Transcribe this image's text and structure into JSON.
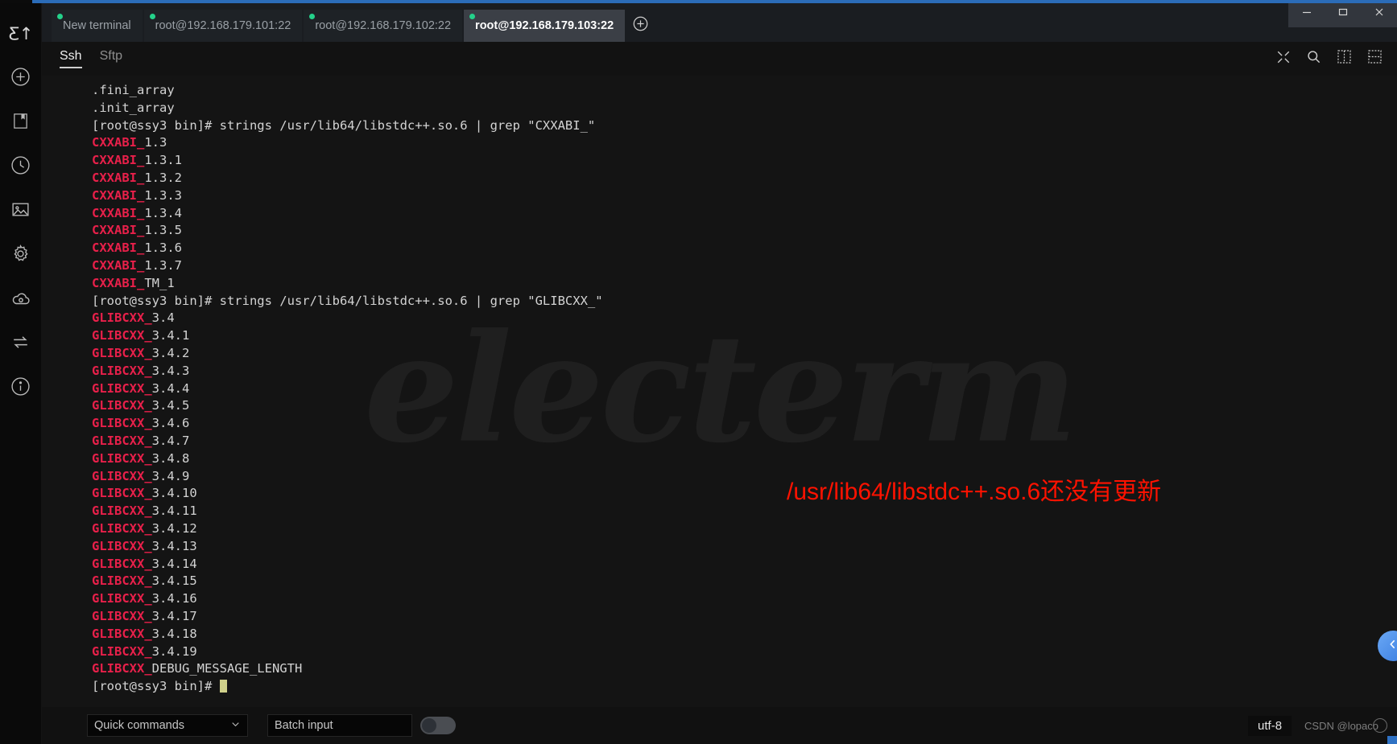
{
  "window": {
    "controls": [
      {
        "name": "minimize",
        "glyph": "minimize-icon"
      },
      {
        "name": "maximize",
        "glyph": "maximize-icon"
      },
      {
        "name": "close",
        "glyph": "close-icon"
      }
    ],
    "accent_color": "#2b6cb8"
  },
  "sidebar": {
    "logo_text": "Ƹ↑",
    "items": [
      {
        "icon": "plus-circle-icon",
        "label": "New"
      },
      {
        "icon": "bookmark-icon",
        "label": "Bookmarks"
      },
      {
        "icon": "clock-icon",
        "label": "History"
      },
      {
        "icon": "image-icon",
        "label": "Theme"
      },
      {
        "icon": "gear-icon",
        "label": "Settings"
      },
      {
        "icon": "cloud-icon",
        "label": "Sync"
      },
      {
        "icon": "transfer-icon",
        "label": "Transfer"
      },
      {
        "icon": "info-icon",
        "label": "About"
      }
    ]
  },
  "tabs": {
    "items": [
      {
        "label": "New terminal",
        "active": false,
        "status": "connected"
      },
      {
        "label": "root@192.168.179.101:22",
        "active": false,
        "status": "connected"
      },
      {
        "label": "root@192.168.179.102:22",
        "active": false,
        "status": "connected"
      },
      {
        "label": "root@192.168.179.103:22",
        "active": true,
        "status": "connected"
      }
    ],
    "add_label": "+",
    "status_dot_color": "#24d18a"
  },
  "subbar": {
    "tabs": [
      {
        "label": "Ssh",
        "active": true
      },
      {
        "label": "Sftp",
        "active": false
      }
    ],
    "tools": [
      {
        "icon": "fullscreen-icon",
        "label": "Toggle fullscreen"
      },
      {
        "icon": "search-icon",
        "label": "Search"
      },
      {
        "icon": "split-vertical-icon",
        "label": "Split vertically"
      },
      {
        "icon": "split-horizontal-icon",
        "label": "Split horizontally"
      }
    ]
  },
  "terminal": {
    "watermark": "electerm",
    "prompt": "[root@ssy3 bin]#",
    "lines": [
      {
        "type": "plain",
        "text": ".fini_array"
      },
      {
        "type": "plain",
        "text": ".init_array"
      },
      {
        "type": "prompt",
        "prompt": "[root@ssy3 bin]# ",
        "command": "strings /usr/lib64/libstdc++.so.6 | grep \"CXXABI_\""
      },
      {
        "type": "match",
        "match": "CXXABI_",
        "rest": "1.3"
      },
      {
        "type": "match",
        "match": "CXXABI_",
        "rest": "1.3.1"
      },
      {
        "type": "match",
        "match": "CXXABI_",
        "rest": "1.3.2"
      },
      {
        "type": "match",
        "match": "CXXABI_",
        "rest": "1.3.3"
      },
      {
        "type": "match",
        "match": "CXXABI_",
        "rest": "1.3.4"
      },
      {
        "type": "match",
        "match": "CXXABI_",
        "rest": "1.3.5"
      },
      {
        "type": "match",
        "match": "CXXABI_",
        "rest": "1.3.6"
      },
      {
        "type": "match",
        "match": "CXXABI_",
        "rest": "1.3.7"
      },
      {
        "type": "match",
        "match": "CXXABI_",
        "rest": "TM_1"
      },
      {
        "type": "prompt",
        "prompt": "[root@ssy3 bin]# ",
        "command": "strings /usr/lib64/libstdc++.so.6 | grep \"GLIBCXX_\""
      },
      {
        "type": "match",
        "match": "GLIBCXX_",
        "rest": "3.4"
      },
      {
        "type": "match",
        "match": "GLIBCXX_",
        "rest": "3.4.1"
      },
      {
        "type": "match",
        "match": "GLIBCXX_",
        "rest": "3.4.2"
      },
      {
        "type": "match",
        "match": "GLIBCXX_",
        "rest": "3.4.3"
      },
      {
        "type": "match",
        "match": "GLIBCXX_",
        "rest": "3.4.4"
      },
      {
        "type": "match",
        "match": "GLIBCXX_",
        "rest": "3.4.5"
      },
      {
        "type": "match",
        "match": "GLIBCXX_",
        "rest": "3.4.6"
      },
      {
        "type": "match",
        "match": "GLIBCXX_",
        "rest": "3.4.7"
      },
      {
        "type": "match",
        "match": "GLIBCXX_",
        "rest": "3.4.8"
      },
      {
        "type": "match",
        "match": "GLIBCXX_",
        "rest": "3.4.9"
      },
      {
        "type": "match",
        "match": "GLIBCXX_",
        "rest": "3.4.10"
      },
      {
        "type": "match",
        "match": "GLIBCXX_",
        "rest": "3.4.11"
      },
      {
        "type": "match",
        "match": "GLIBCXX_",
        "rest": "3.4.12"
      },
      {
        "type": "match",
        "match": "GLIBCXX_",
        "rest": "3.4.13"
      },
      {
        "type": "match",
        "match": "GLIBCXX_",
        "rest": "3.4.14"
      },
      {
        "type": "match",
        "match": "GLIBCXX_",
        "rest": "3.4.15"
      },
      {
        "type": "match",
        "match": "GLIBCXX_",
        "rest": "3.4.16"
      },
      {
        "type": "match",
        "match": "GLIBCXX_",
        "rest": "3.4.17"
      },
      {
        "type": "match",
        "match": "GLIBCXX_",
        "rest": "3.4.18"
      },
      {
        "type": "match",
        "match": "GLIBCXX_",
        "rest": "3.4.19"
      },
      {
        "type": "match",
        "match": "GLIBCXX_",
        "rest": "DEBUG_MESSAGE_LENGTH"
      },
      {
        "type": "cursor",
        "prompt": "[root@ssy3 bin]# "
      }
    ],
    "match_color": "#e8204a",
    "text_color": "#d3d3d3",
    "cursor_color": "#cfd08a"
  },
  "annotation": {
    "text": "/usr/lib64/libstdc++.so.6还没有更新",
    "color": "#ff1200"
  },
  "edge_handle": {
    "icon": "chevron-left-icon",
    "label": "Collapse panel"
  },
  "bottombar": {
    "quick_commands_label": "Quick commands",
    "batch_input_placeholder": "Batch input",
    "batch_input_value": "",
    "toggle_on": false,
    "encoding": "utf-8",
    "watermark": "CSDN @lopaco"
  }
}
